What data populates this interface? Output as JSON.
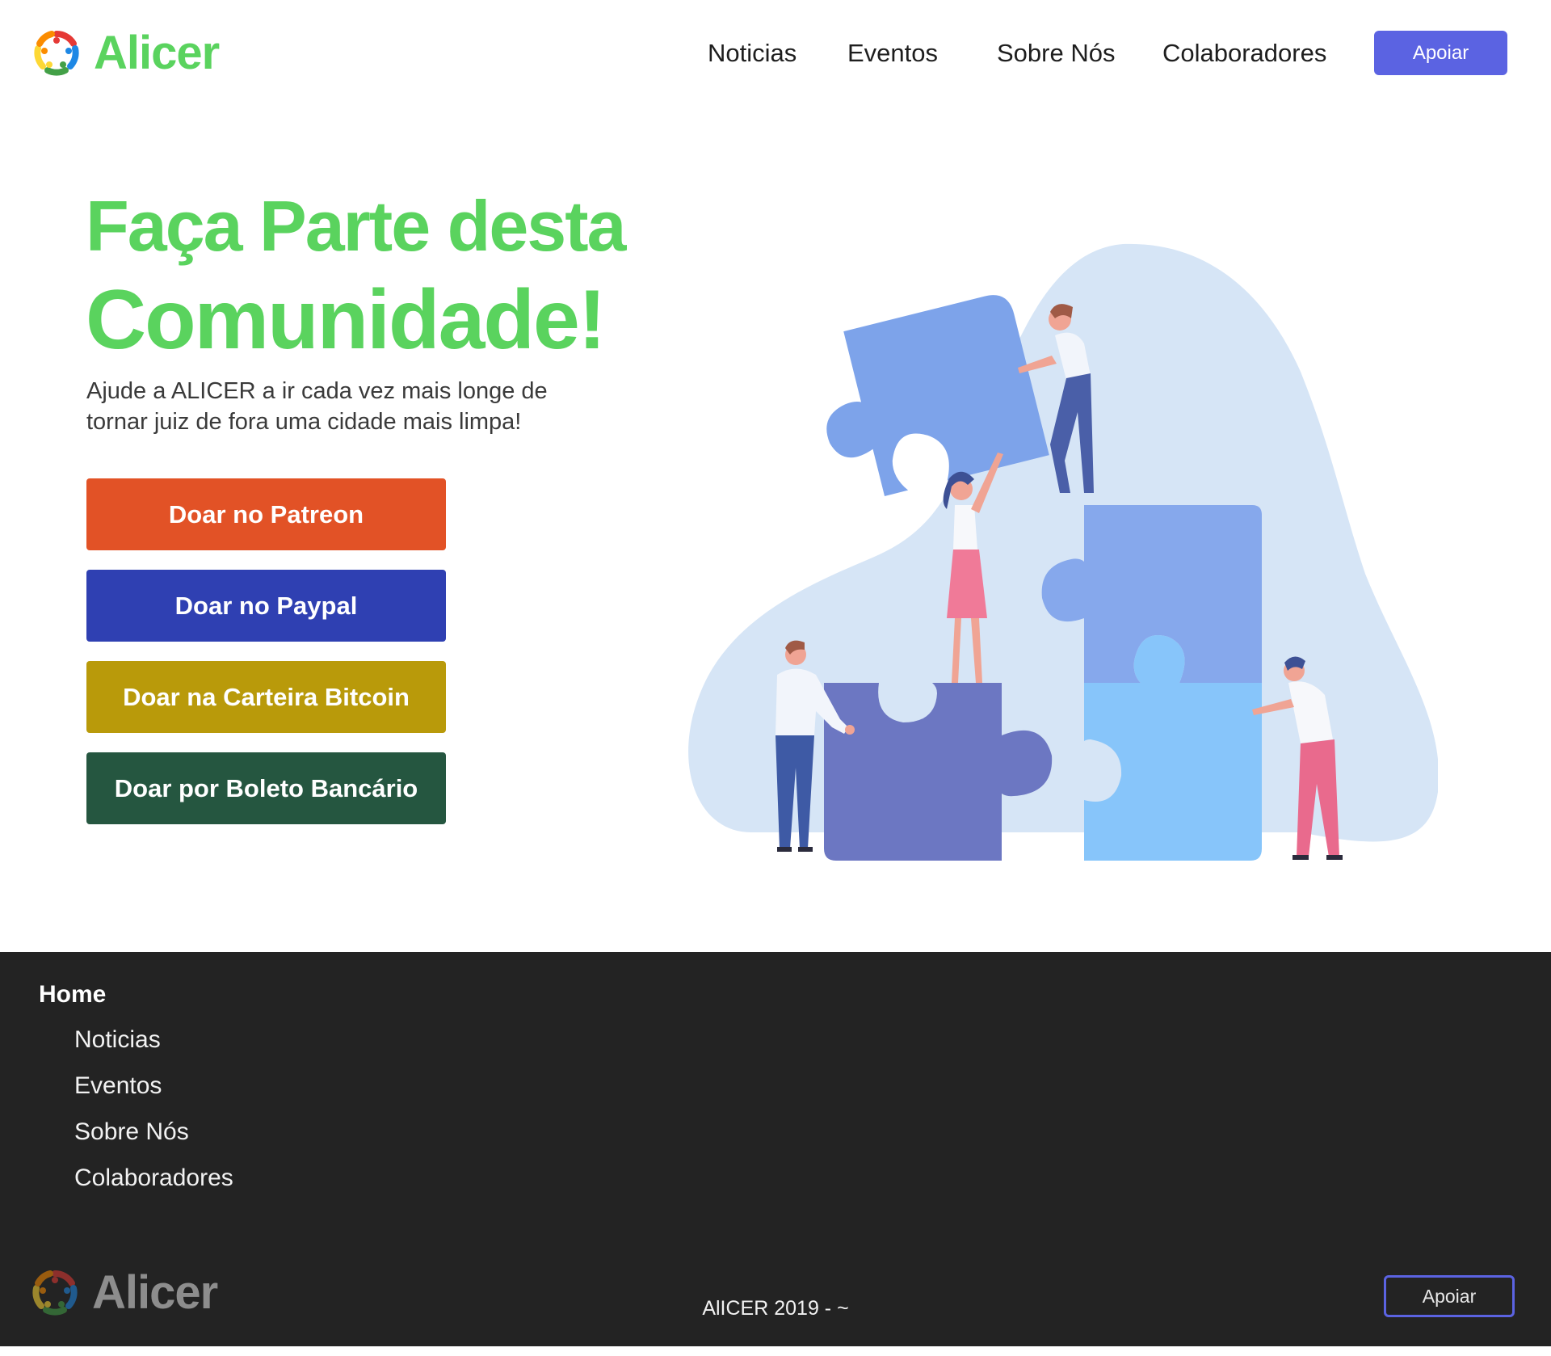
{
  "header": {
    "logo_text": "Alicer",
    "nav": [
      {
        "label": "Noticias"
      },
      {
        "label": "Eventos"
      },
      {
        "label": "Sobre Nós"
      },
      {
        "label": "Colaboradores"
      }
    ],
    "cta_label": "Apoiar"
  },
  "hero": {
    "title_line1": "Faça Parte desta",
    "title_line2": "Comunidade!",
    "subtitle": "Ajude a ALICER a ir cada vez mais longe de tornar juiz de fora uma cidade mais limpa!",
    "buttons": [
      {
        "label": "Doar no Patreon",
        "color": "#e25226"
      },
      {
        "label": "Doar no Paypal",
        "color": "#2f40b2"
      },
      {
        "label": "Doar na Carteira Bitcoin",
        "color": "#b99a0a"
      },
      {
        "label": "Doar por Boleto Bancário",
        "color": "#255640"
      }
    ]
  },
  "footer": {
    "home_label": "Home",
    "links": [
      {
        "label": "Noticias"
      },
      {
        "label": "Eventos"
      },
      {
        "label": "Sobre Nós"
      },
      {
        "label": "Colaboradores"
      }
    ],
    "logo_text": "Alicer",
    "copyright": "AlICER 2019 - ~",
    "cta_label": "Apoiar"
  },
  "colors": {
    "brand_green": "#5ad35e",
    "accent_purple": "#5b63e2",
    "footer_bg": "#232323"
  },
  "icons": [
    "alicer-logo-icon",
    "puzzle-teamwork-illustration"
  ]
}
